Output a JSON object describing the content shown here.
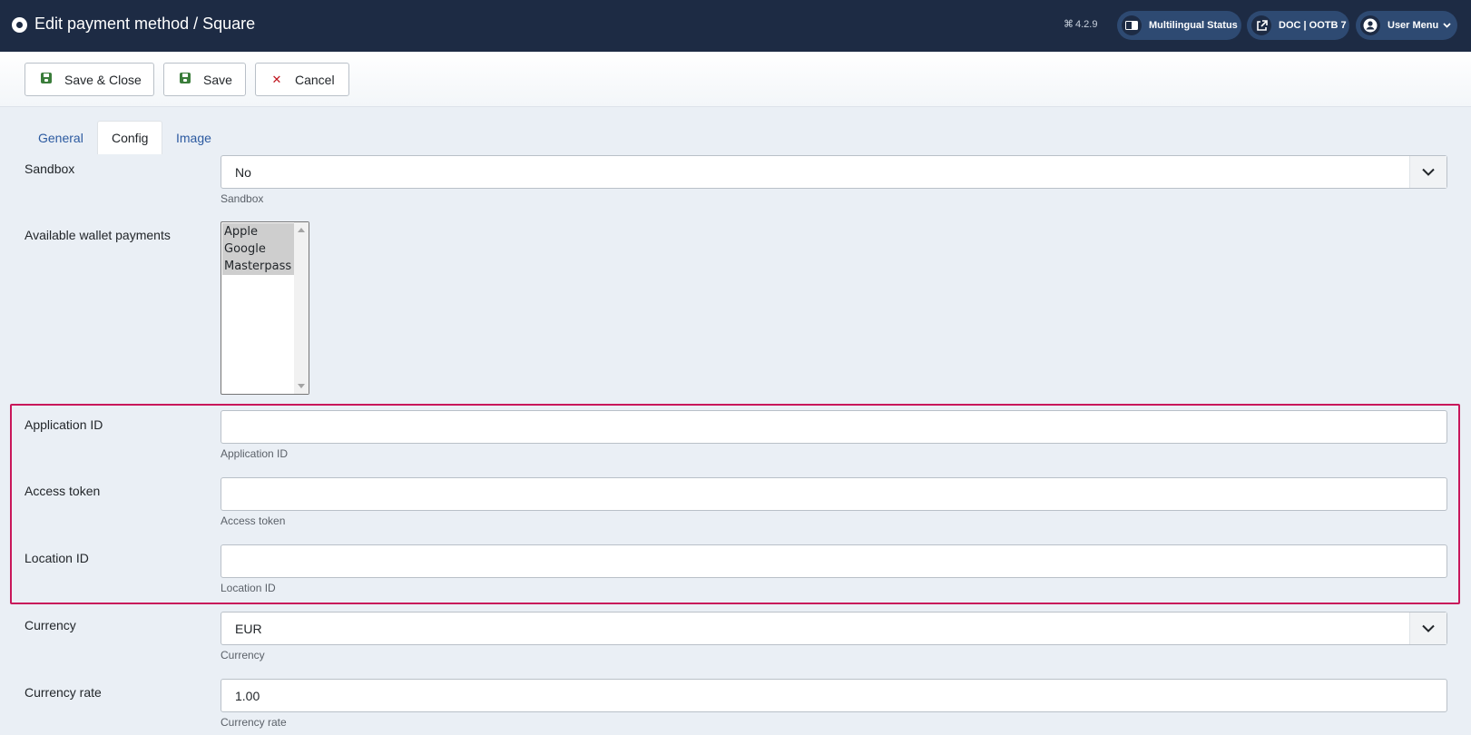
{
  "header": {
    "title": "Edit payment method / Square",
    "version": "4.2.9",
    "multilingual_label": "Multilingual Status",
    "doc_label": "DOC | OOTB 7",
    "user_menu_label": "User Menu",
    "background_color": "#1d2b44"
  },
  "toolbar": {
    "save_close_label": "Save & Close",
    "save_label": "Save",
    "cancel_label": "Cancel"
  },
  "tabs": [
    {
      "label": "General",
      "active": false
    },
    {
      "label": "Config",
      "active": true
    },
    {
      "label": "Image",
      "active": false
    }
  ],
  "fields": {
    "sandbox": {
      "label": "Sandbox",
      "value": "No",
      "help": "Sandbox"
    },
    "wallet": {
      "label": "Available wallet payments",
      "options": [
        "Apple",
        "Google",
        "Masterpass"
      ]
    },
    "application_id": {
      "label": "Application ID",
      "value": "",
      "help": "Application ID"
    },
    "access_token": {
      "label": "Access token",
      "value": "",
      "help": "Access token"
    },
    "location_id": {
      "label": "Location ID",
      "value": "",
      "help": "Location ID"
    },
    "currency": {
      "label": "Currency",
      "value": "EUR",
      "help": "Currency"
    },
    "currency_rate": {
      "label": "Currency rate",
      "value": "1.00",
      "help": "Currency rate"
    }
  },
  "highlight_color": "#c8175a"
}
